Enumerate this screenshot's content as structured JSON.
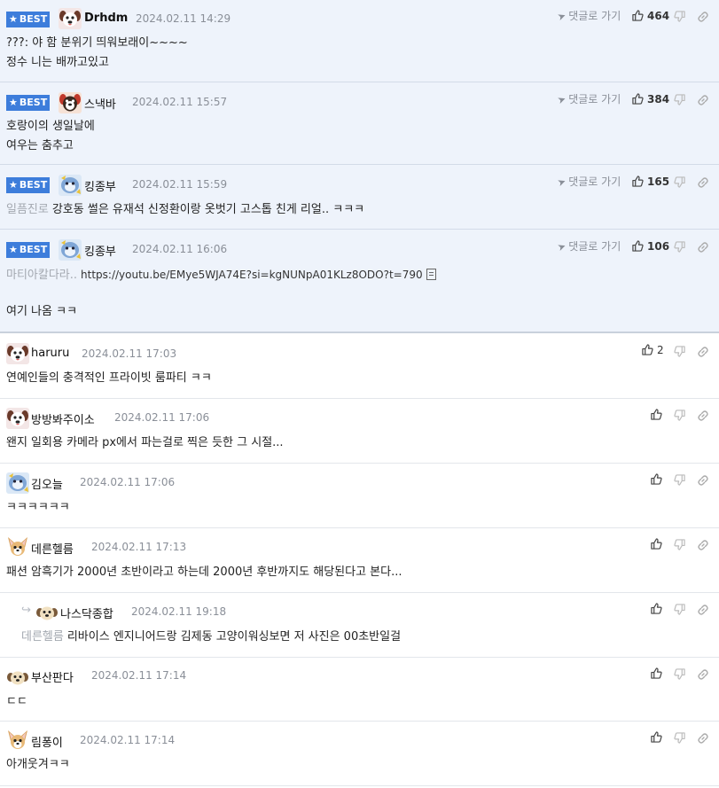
{
  "best_label": "BEST",
  "reply_label": "댓글로 가기",
  "colors": {
    "best_badge": "#3d7ddb",
    "best_bg": "#eef3fb",
    "divider": "#e3e6eb",
    "meta_gray": "#8a8f98",
    "mention_gray": "#a3a8b0"
  },
  "best_comments": [
    {
      "nick": "Drhdm",
      "date": "2024.02.11 14:29",
      "likes": "464",
      "avatar": "dog-avatar-icon",
      "lines": [
        "???: 야 함 분위기 띄워보래이~~~~",
        "정수 니는 배까고있고"
      ]
    },
    {
      "nick": "스낵바",
      "date": "2024.02.11 15:57",
      "likes": "384",
      "avatar": "red-dog-avatar-icon",
      "lines": [
        "호랑이의 생일날에",
        "여우는 춤추고"
      ]
    },
    {
      "nick": "킹종부",
      "date": "2024.02.11 15:59",
      "likes": "165",
      "avatar": "blue-avatar-icon",
      "mention": "일픔진로",
      "lines": [
        "강호동 썰은 유재석 신정환이랑 옷벗기 고스톱 친게 리얼.. ㅋㅋㅋ"
      ]
    },
    {
      "nick": "킹종부",
      "date": "2024.02.11 16:06",
      "likes": "106",
      "avatar": "blue-avatar-icon",
      "mention": "마티아칼다라..",
      "url": "https://youtu.be/EMye5WJA74E?si=kgNUNpA01KLz8ODO?t=790",
      "lines": [
        "여기 나옴 ㅋㅋ"
      ]
    }
  ],
  "comments": [
    {
      "nick": "haruru",
      "date": "2024.02.11 17:03",
      "likes": "2",
      "avatar": "dog-avatar-icon",
      "text": "연예인들의 충격적인 프라이빗 룸파티 ㅋㅋ"
    },
    {
      "nick": "방방봐주이소",
      "date": "2024.02.11 17:06",
      "likes": "",
      "avatar": "dog-avatar-icon",
      "text": "왠지 일회용 카메라 px에서 파는걸로 찍은 듯한 그 시절..."
    },
    {
      "nick": "김오늘",
      "date": "2024.02.11 17:06",
      "likes": "",
      "avatar": "blue-avatar-icon",
      "text": "ㅋㅋㅋㅋㅋㅋ"
    },
    {
      "nick": "데른헬름",
      "date": "2024.02.11 17:13",
      "likes": "",
      "avatar": "chihuahua-avatar-icon",
      "text": "패션 암흑기가 2000년 초반이라고 하는데 2000년 후반까지도 해당된다고 본다..."
    },
    {
      "nick": "나스닥종합",
      "date": "2024.02.11 19:18",
      "likes": "",
      "avatar": "puppy-avatar-icon",
      "mention": "데른헬름",
      "text": "리바이스 엔지니어드랑 김제동 고양이워싱보면 저 사진은 00초반일걸",
      "reply": true
    },
    {
      "nick": "부산판다",
      "date": "2024.02.11 17:14",
      "likes": "",
      "avatar": "puppy-avatar-icon",
      "text": "ㄷㄷ"
    },
    {
      "nick": "림퐁이",
      "date": "2024.02.11 17:14",
      "likes": "",
      "avatar": "chihuahua-avatar-icon",
      "text": "아개웃겨ㅋㅋ"
    }
  ]
}
